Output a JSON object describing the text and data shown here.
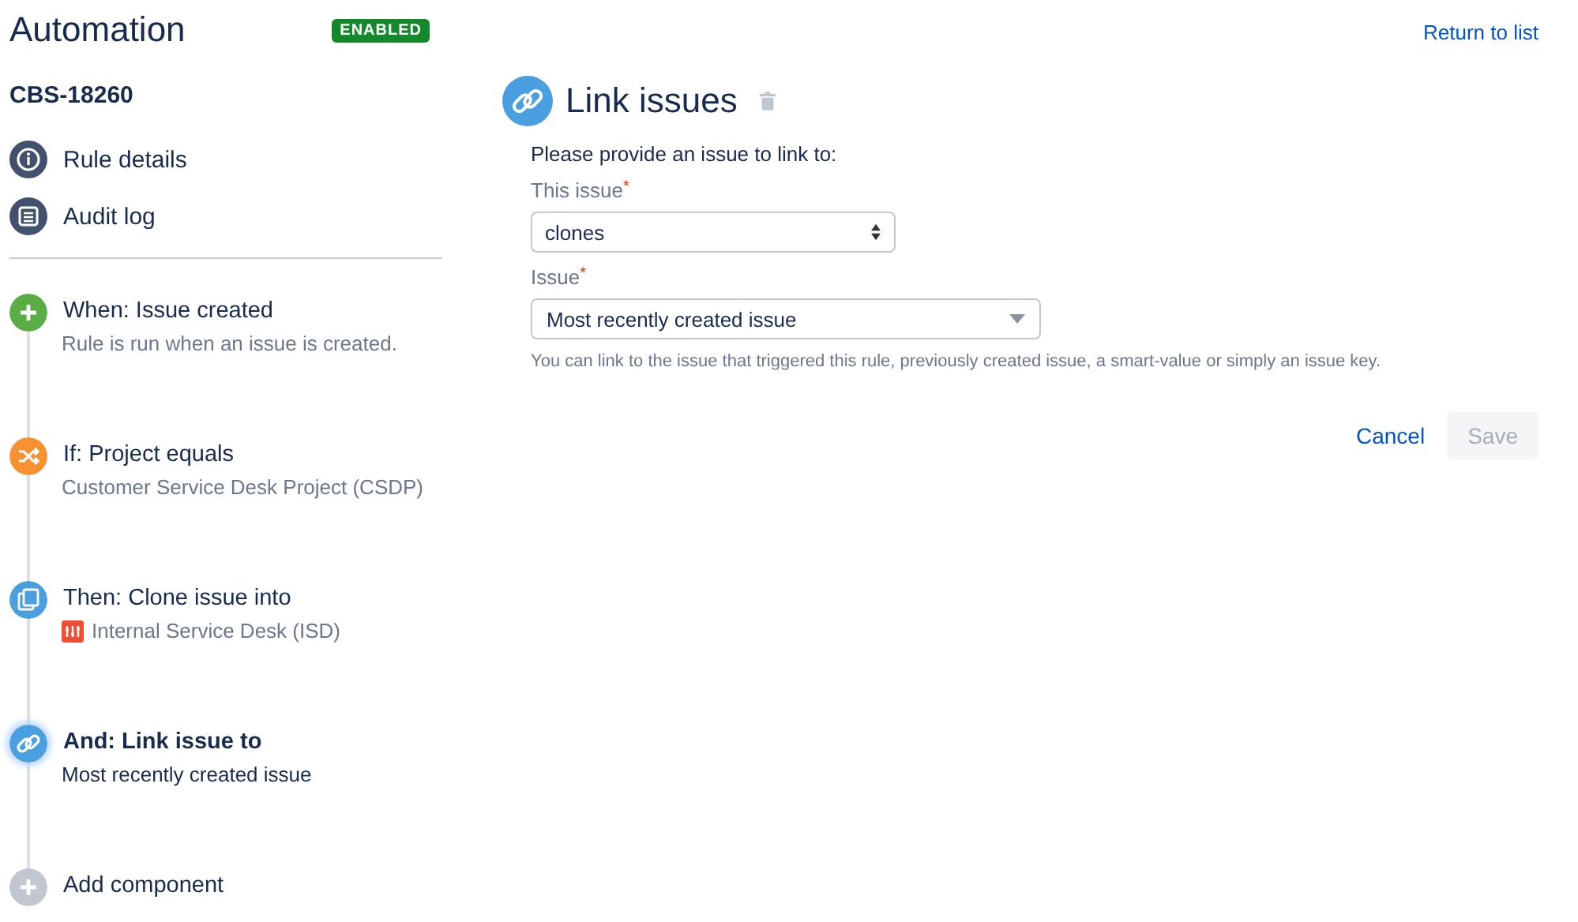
{
  "header": {
    "title": "Automation",
    "status_badge": "ENABLED",
    "return_link": "Return to list"
  },
  "rule_key": "CBS-18260",
  "nav": [
    {
      "kind": "info",
      "label": "Rule details"
    },
    {
      "kind": "log",
      "label": "Audit log"
    }
  ],
  "steps": [
    {
      "kind": "trigger",
      "title": "When: Issue created",
      "description": "Rule is run when an issue is created.",
      "selected": false
    },
    {
      "kind": "condition",
      "title": "If: Project equals",
      "description": "Customer Service Desk Project (CSDP)",
      "selected": false
    },
    {
      "kind": "clone",
      "title": "Then: Clone issue into",
      "description": "Internal Service Desk (ISD)",
      "project_icon": true,
      "selected": false
    },
    {
      "kind": "link",
      "title": "And: Link issue to",
      "description": "Most recently created issue",
      "selected": true
    },
    {
      "kind": "add",
      "title": "Add component",
      "selected": false
    }
  ],
  "panel": {
    "title": "Link issues",
    "intro": "Please provide an issue to link to:",
    "fields": [
      {
        "kind": "native-select",
        "label": "This issue",
        "required_mark": "*",
        "value": "clones"
      },
      {
        "kind": "dropdown",
        "label": "Issue",
        "required_mark": "*",
        "value": "Most recently created issue"
      }
    ],
    "help": "You can link to the issue that triggered this rule, previously created issue, a smart-value or simply an issue key.",
    "cancel": "Cancel",
    "save": {
      "label": "Save",
      "disabled": true
    }
  }
}
